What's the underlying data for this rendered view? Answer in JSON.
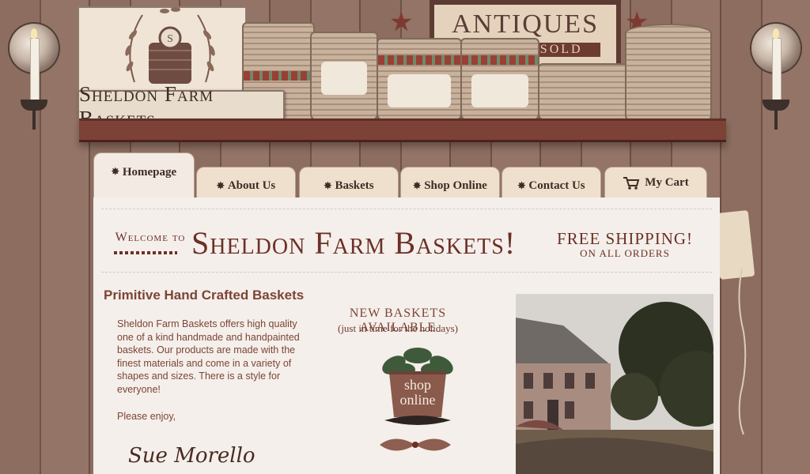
{
  "site": {
    "logo_text": "Sheldon Farm Baskets",
    "sign_top": "ANTIQUES",
    "sign_bottom": "BOUGHT SOLD"
  },
  "nav": {
    "tabs": [
      {
        "label": "Homepage",
        "active": true
      },
      {
        "label": "About Us",
        "active": false
      },
      {
        "label": "Baskets",
        "active": false
      },
      {
        "label": "Shop Online",
        "active": false
      },
      {
        "label": "Contact Us",
        "active": false
      },
      {
        "label": "My Cart",
        "active": false
      }
    ]
  },
  "welcome": {
    "prefix": "Welcome to",
    "title": "Sheldon Farm Baskets!",
    "shipping_line1": "FREE SHIPPING!",
    "shipping_line2": "ON ALL ORDERS"
  },
  "intro": {
    "heading": "Primitive Hand Crafted Baskets",
    "body": "Sheldon Farm Baskets offers high quality one of a kind handmade and handpainted baskets. Our products are made with the finest materials and come in a variety of shapes and sizes. There is a style for everyone!",
    "closing": "Please enjoy,",
    "signature": "Sue Morello"
  },
  "promo": {
    "heading": "NEW BASKETS AVAILABLE",
    "subheading": "(just in time for the holidays)",
    "shop_label_1": "shop",
    "shop_label_2": "online"
  },
  "colors": {
    "accent": "#6d2f27",
    "text": "#7d4436",
    "panel": "#f4efea",
    "shelf": "#7d4237"
  },
  "icons": [
    "cart-icon",
    "star-bullet-icon",
    "candle-sconce-icon"
  ]
}
